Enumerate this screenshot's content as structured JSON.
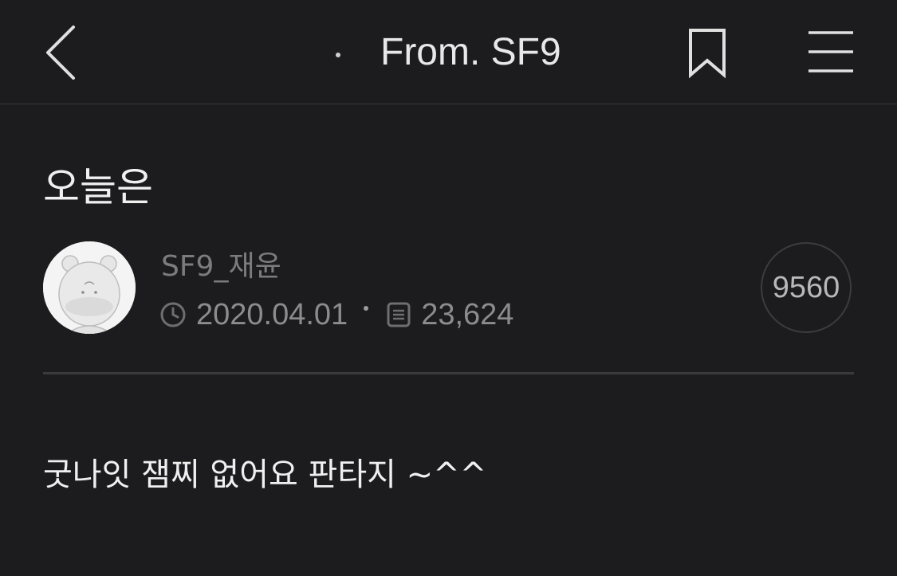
{
  "header": {
    "title": "From. SF9",
    "back_icon": "chevron-left-icon",
    "bookmark_icon": "bookmark-icon",
    "menu_icon": "hamburger-menu-icon"
  },
  "post": {
    "title": "오늘은",
    "author": "SF9_재윤",
    "date": "2020.04.01",
    "views": "23,624",
    "likes": "9560",
    "body": "굿나잇 잼찌 없어요 판타지 ~^^"
  },
  "colors": {
    "background": "#1c1c1e",
    "divider": "#3a3a3c",
    "meta_text": "#8c8c90"
  }
}
